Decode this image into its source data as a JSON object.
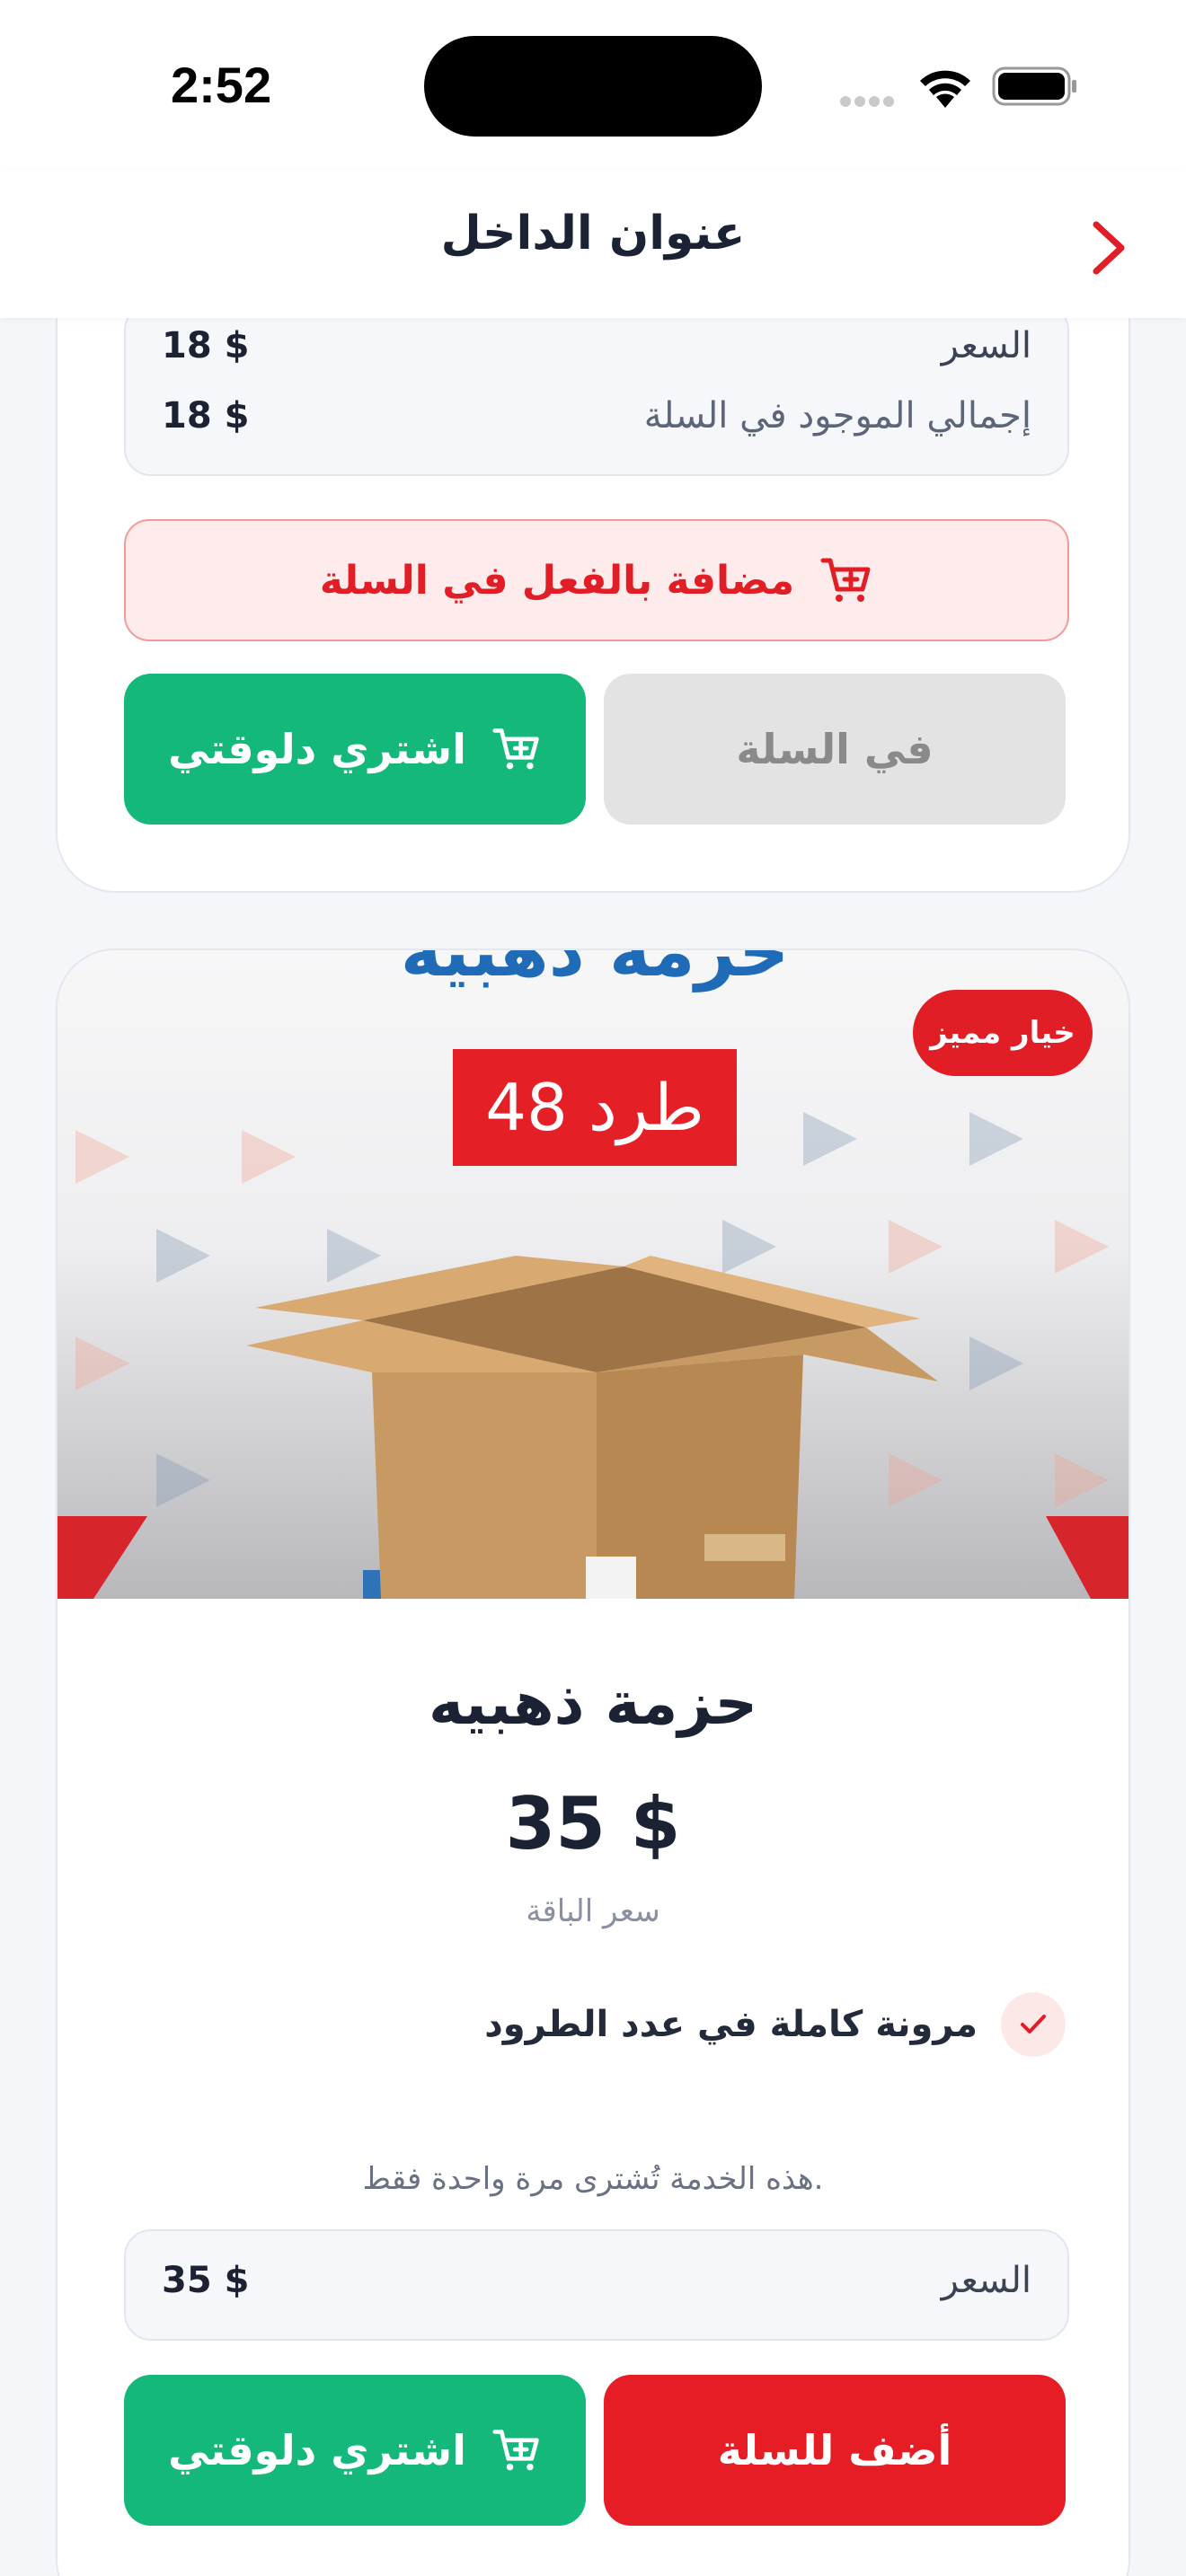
{
  "status_bar": {
    "time": "2:52"
  },
  "nav": {
    "title": "عنوان الداخل"
  },
  "card1": {
    "price_label": "السعر",
    "price_value": "18 $",
    "total_label": "إجمالي الموجود في السلة",
    "total_value": "18 $",
    "added_banner": "مضافة بالفعل في السلة",
    "buy_now_label": "اشتري دلوقتي",
    "in_cart_label": "في السلة"
  },
  "card2": {
    "badge": "خيار مميز",
    "image_title": "حزمة ذهبيه",
    "image_subtitle": "48 طرد",
    "title": "حزمة ذهبيه",
    "price": "35 $",
    "price_caption": "سعر الباقة",
    "feature": "مرونة كاملة في عدد الطرود",
    "note": "هذه الخدمة تُشترى مرة واحدة فقط.",
    "price_label": "السعر",
    "price_value": "35 $",
    "buy_now_label": "اشتري دلوقتي",
    "add_to_cart_label": "أضف للسلة"
  },
  "colors": {
    "accent_red": "#e11d26",
    "accent_green": "#14b87a"
  },
  "icons": [
    "back-chevron-icon",
    "cart-icon",
    "check-icon",
    "wifi-icon",
    "battery-icon"
  ]
}
